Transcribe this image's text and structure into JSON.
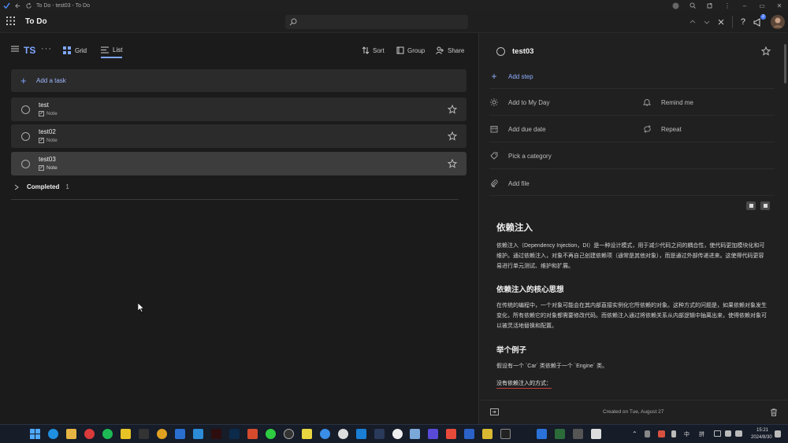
{
  "titlebar": {
    "title": "To Do - test03 - To Do"
  },
  "header": {
    "app_name": "To Do",
    "search_placeholder": "",
    "notification_count": "2"
  },
  "list": {
    "title": "TS",
    "more": "···",
    "views": [
      {
        "label": "Grid",
        "icon": "grid-icon",
        "active": false
      },
      {
        "label": "List",
        "icon": "list-icon",
        "active": true
      }
    ],
    "actions": [
      {
        "label": "Sort",
        "icon": "sort-icon"
      },
      {
        "label": "Group",
        "icon": "group-icon"
      },
      {
        "label": "Share",
        "icon": "share-icon"
      }
    ],
    "add_task_label": "Add a task",
    "tasks": [
      {
        "name": "test",
        "note": "Note",
        "selected": false
      },
      {
        "name": "test02",
        "note": "Note",
        "selected": false
      },
      {
        "name": "test03",
        "note": "Note",
        "selected": true
      }
    ],
    "completed_label": "Completed",
    "completed_count": "1"
  },
  "detail": {
    "title": "test03",
    "add_step": "Add step",
    "add_to_my_day": "Add to My Day",
    "remind_me": "Remind me",
    "add_due_date": "Add due date",
    "repeat": "Repeat",
    "pick_category": "Pick a category",
    "add_file": "Add file",
    "notes": {
      "h1": "依赖注入",
      "p1": "依赖注入（Dependency Injection，DI）是一种设计模式，用于减少代码之间的耦合性，使代码更加模块化和可维护。通过依赖注入，对象不再自己创建依赖项（通常是其他对象），而是通过外部传递进来。这使得代码更容易进行单元测试、维护和扩展。",
      "h2": "依赖注入的核心思想",
      "p2": "在传统的编程中，一个对象可能会在其内部直接实例化它所依赖的对象。这种方式的问题是，如果依赖对象发生变化，所有依赖它的对象都需要修改代码。而依赖注入通过将依赖关系从内部逻辑中抽离出来，使得依赖对象可以被灵活地替换和配置。",
      "h3": "举个例子",
      "p3": "假设有一个 `Car` 类依赖于一个 `Engine` 类。",
      "p4": "没有依赖注入的方式："
    },
    "created": "Created on Tue, August 27"
  },
  "taskbar": {
    "clock_time": "15:21",
    "clock_date": "2024/8/30",
    "ime1": "中",
    "ime2": "拼"
  }
}
